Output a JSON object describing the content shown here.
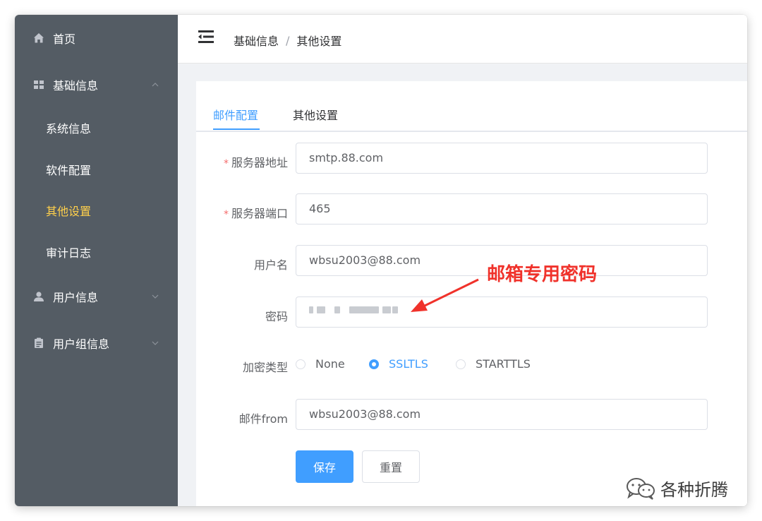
{
  "sidebar": {
    "items": [
      {
        "label": "首页",
        "icon": "home-icon"
      },
      {
        "label": "基础信息",
        "icon": "grid-icon",
        "expanded": true
      },
      {
        "label": "系统信息"
      },
      {
        "label": "软件配置"
      },
      {
        "label": "其他设置",
        "active": true
      },
      {
        "label": "审计日志"
      },
      {
        "label": "用户信息",
        "icon": "user-icon"
      },
      {
        "label": "用户组信息",
        "icon": "clipboard-icon"
      }
    ],
    "colors": {
      "background": "#545c64",
      "text": "#ffffff",
      "active": "#ffd04b"
    }
  },
  "header": {
    "breadcrumb": [
      "基础信息",
      "其他设置"
    ],
    "separator": "/"
  },
  "tabs": [
    {
      "label": "邮件配置",
      "active": true
    },
    {
      "label": "其他设置"
    }
  ],
  "form": {
    "server_address": {
      "label": "服务器地址",
      "required": true,
      "value": "smtp.88.com"
    },
    "server_port": {
      "label": "服务器端口",
      "required": true,
      "value": "465"
    },
    "username": {
      "label": "用户名",
      "value": "wbsu2003@88.com"
    },
    "password": {
      "label": "密码"
    },
    "encryption": {
      "label": "加密类型",
      "options": [
        "None",
        "SSLTLS",
        "STARTTLS"
      ],
      "selected": "SSLTLS"
    },
    "mail_from": {
      "label": "邮件from",
      "value": "wbsu2003@88.com"
    },
    "required_mark": "*"
  },
  "buttons": {
    "save": "保存",
    "reset": "重置"
  },
  "annotation": {
    "text": "邮箱专用密码",
    "color": "#f0322b"
  },
  "watermark": {
    "text": "各种折腾"
  },
  "accent_color": "#409eff"
}
